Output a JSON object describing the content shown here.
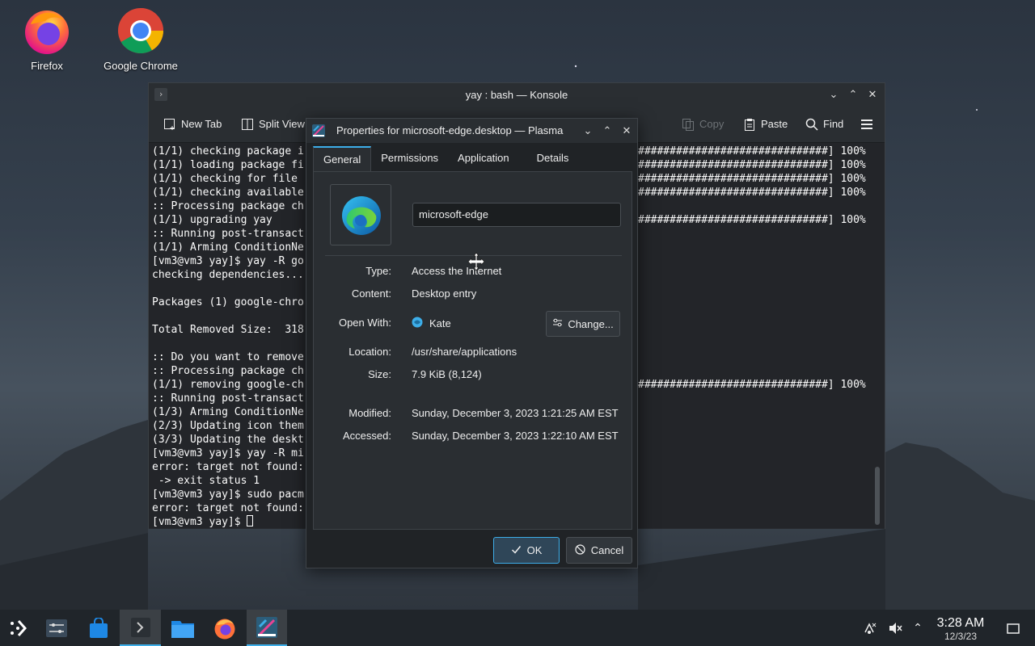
{
  "desktop": {
    "icons": [
      {
        "label": "Firefox"
      },
      {
        "label": "Google Chrome"
      }
    ]
  },
  "konsole": {
    "title": "yay : bash — Konsole",
    "toolbar": {
      "new_tab": "New Tab",
      "split_view": "Split View",
      "copy": "Copy",
      "paste": "Paste",
      "find": "Find"
    },
    "lines": [
      "(1/1) checking package i",
      "(1/1) loading package fi",
      "(1/1) checking for file ",
      "(1/1) checking available",
      ":: Processing package ch",
      "(1/1) upgrading yay",
      ":: Running post-transact",
      "(1/1) Arming ConditionNe",
      "[vm3@vm3 yay]$ yay -R go",
      "checking dependencies...",
      "",
      "Packages (1) google-chro",
      "",
      "Total Removed Size:  318",
      "",
      ":: Do you want to remove",
      ":: Processing package ch",
      "(1/1) removing google-ch",
      ":: Running post-transact",
      "(1/3) Arming ConditionNe",
      "(2/3) Updating icon them",
      "(3/3) Updating the deskt",
      "[vm3@vm3 yay]$ yay -R mi",
      "error: target not found:",
      " -> exit status 1",
      "[vm3@vm3 yay]$ sudo pacm",
      "error: target not found:",
      "[vm3@vm3 yay]$ "
    ],
    "right_lines": [
      "##############################] 100%",
      "##############################] 100%",
      "##############################] 100%",
      "##############################] 100%",
      "",
      "##############################] 100%",
      "",
      "",
      "",
      "",
      "",
      "",
      "",
      "",
      "",
      "",
      "",
      "##############################] 100%"
    ]
  },
  "dialog": {
    "title": "Properties for microsoft-edge.desktop — Plasma",
    "tabs": [
      "General",
      "Permissions",
      "Application",
      "Details"
    ],
    "active_tab": "General",
    "name_value": "microsoft-edge",
    "fields": {
      "type_label": "Type:",
      "type_value": "Access the Internet",
      "content_label": "Content:",
      "content_value": "Desktop entry",
      "openwith_label": "Open With:",
      "openwith_value": "Kate",
      "change_label": "Change...",
      "location_label": "Location:",
      "location_value": "/usr/share/applications",
      "size_label": "Size:",
      "size_value": "7.9 KiB (8,124)",
      "modified_label": "Modified:",
      "modified_value": "Sunday, December 3, 2023 1:21:25 AM EST",
      "accessed_label": "Accessed:",
      "accessed_value": "Sunday, December 3, 2023 1:22:10 AM EST"
    },
    "ok_label": "OK",
    "cancel_label": "Cancel"
  },
  "taskbar": {
    "time": "3:28 AM",
    "date": "12/3/23"
  },
  "colors": {
    "accent": "#3daee9",
    "window_bg": "#2a2e32",
    "terminal_bg": "#232629"
  }
}
